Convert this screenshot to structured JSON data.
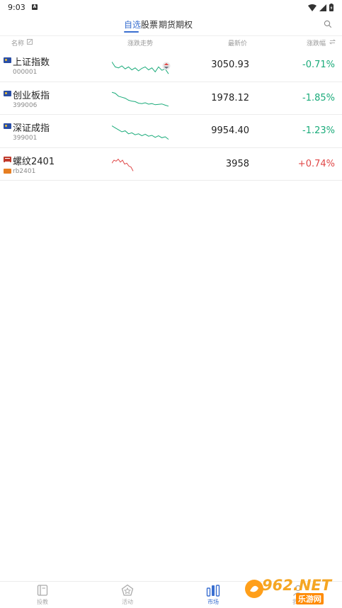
{
  "status": {
    "time": "9:03"
  },
  "tabs": [
    {
      "label": "自选"
    },
    {
      "label": "股票"
    },
    {
      "label": "期货"
    },
    {
      "label": "期权"
    }
  ],
  "columns": {
    "name": "名称",
    "trend": "涨跌走势",
    "price": "最新价",
    "change": "涨跌幅"
  },
  "rows": [
    {
      "name": "上证指数",
      "code": "000001",
      "price": "3050.93",
      "change": "-0.71%",
      "direction": "down",
      "spark": [
        0.3,
        0.55,
        0.6,
        0.5,
        0.65,
        0.55,
        0.7,
        0.6,
        0.75,
        0.62,
        0.55,
        0.7,
        0.6,
        0.8,
        0.55,
        0.72,
        0.65,
        0.9
      ]
    },
    {
      "name": "创业板指",
      "code": "399006",
      "price": "1978.12",
      "change": "-1.85%",
      "direction": "down",
      "spark": [
        0.15,
        0.2,
        0.35,
        0.4,
        0.45,
        0.55,
        0.6,
        0.62,
        0.7,
        0.72,
        0.68,
        0.75,
        0.72,
        0.78,
        0.76,
        0.74,
        0.8,
        0.85
      ]
    },
    {
      "name": "深证成指",
      "code": "399001",
      "price": "9954.40",
      "change": "-1.23%",
      "direction": "down",
      "spark": [
        0.2,
        0.3,
        0.4,
        0.5,
        0.45,
        0.6,
        0.55,
        0.65,
        0.6,
        0.7,
        0.62,
        0.72,
        0.68,
        0.78,
        0.7,
        0.8,
        0.75,
        0.88
      ]
    },
    {
      "name": "螺纹2401",
      "code": "rb2401",
      "price": "3958",
      "change": "+0.74%",
      "direction": "up",
      "spark": [
        0.4,
        0.25,
        0.3,
        0.2,
        0.35,
        0.25,
        0.45,
        0.4,
        0.55,
        0.6,
        0.8
      ]
    }
  ],
  "nav": [
    {
      "label": "投教"
    },
    {
      "label": "活动"
    },
    {
      "label": "市场"
    },
    {
      "label": "我的"
    }
  ],
  "watermark": {
    "text": "962.NET",
    "sub": "乐游网"
  },
  "colors": {
    "accent": "#3a6fd0",
    "down": "#1aab7a",
    "up": "#e04848"
  }
}
